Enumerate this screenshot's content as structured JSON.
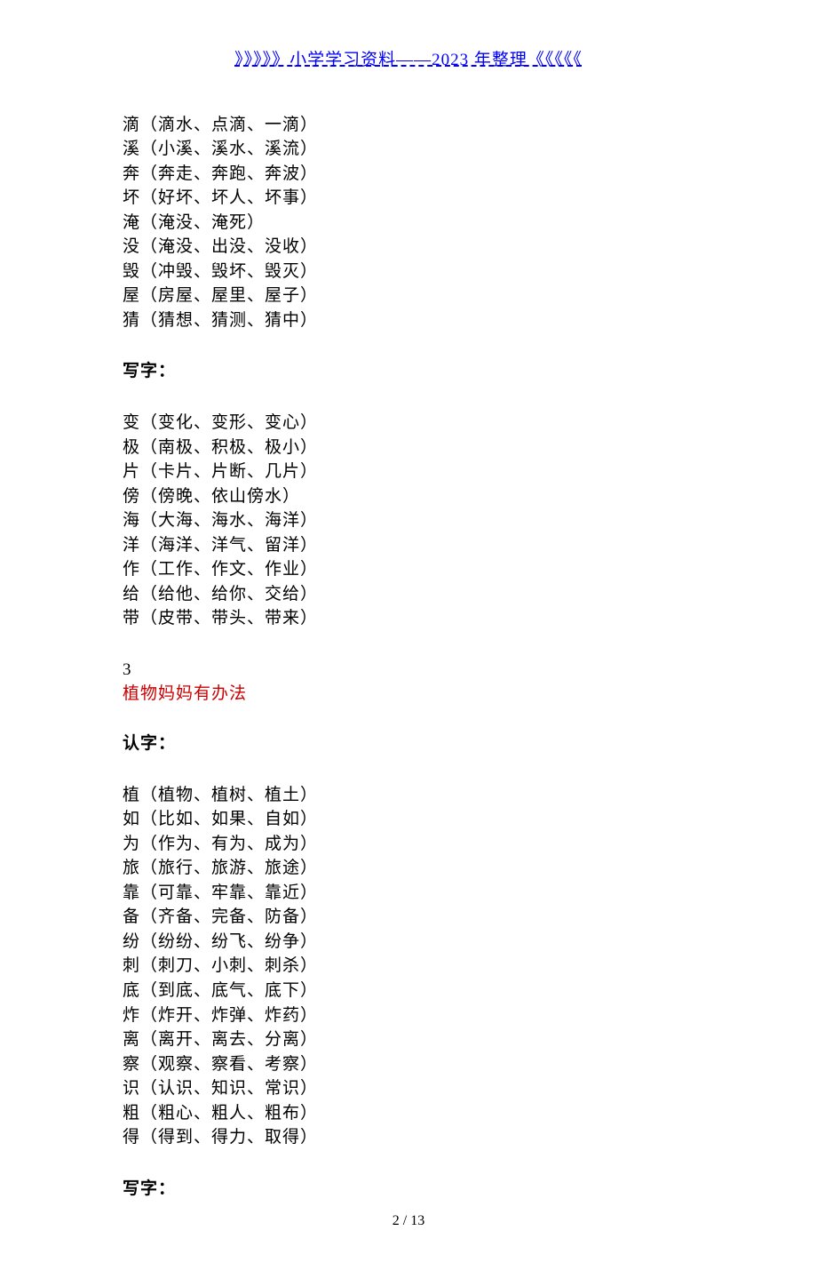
{
  "header": "》》》》》小学学习资料——2023 年整理《《《《《",
  "block1": [
    "滴（滴水、点滴、一滴）",
    "溪（小溪、溪水、溪流）",
    "奔（奔走、奔跑、奔波）",
    "坏（好坏、坏人、坏事）",
    "淹（淹没、淹死）",
    "没（淹没、出没、没收）",
    "毁（冲毁、毁坏、毁灭）",
    "屋（房屋、屋里、屋子）",
    "猜（猜想、猜测、猜中）"
  ],
  "heading_write1": "写字：",
  "block2": [
    "变（变化、变形、变心）",
    "极（南极、积极、极小）",
    "片（卡片、片断、几片）",
    "傍（傍晚、依山傍水）",
    "海（大海、海水、海洋）",
    "洋（海洋、洋气、留洋）",
    "作（工作、作文、作业）",
    "给（给他、给你、交给）",
    "带（皮带、带头、带来）"
  ],
  "lesson_number": "3",
  "lesson_title": "植物妈妈有办法",
  "heading_recognize": "认字：",
  "block3": [
    "植（植物、植树、植土）",
    "如（比如、如果、自如）",
    "为（作为、有为、成为）",
    "旅（旅行、旅游、旅途）",
    "靠（可靠、牢靠、靠近）",
    "备（齐备、完备、防备）",
    "纷（纷纷、纷飞、纷争）",
    "刺（刺刀、小刺、刺杀）",
    "底（到底、底气、底下）",
    "炸（炸开、炸弹、炸药）",
    "离（离开、离去、分离）",
    "察（观察、察看、考察）",
    "识（认识、知识、常识）",
    "粗（粗心、粗人、粗布）",
    "得（得到、得力、取得）"
  ],
  "heading_write2": "写字：",
  "page_number": "2 / 13"
}
